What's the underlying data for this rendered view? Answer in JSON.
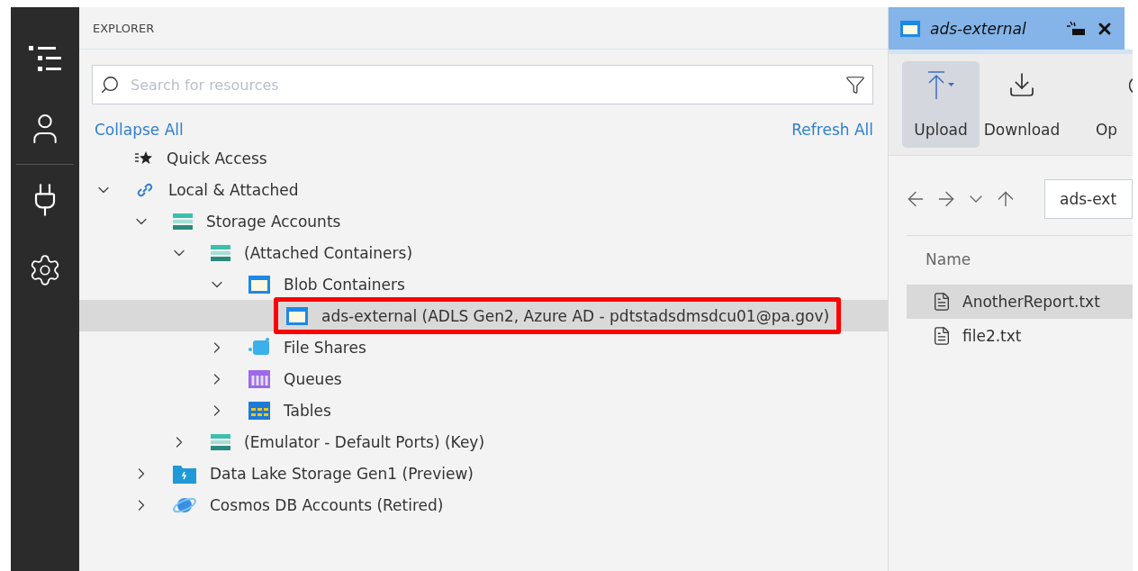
{
  "explorer": {
    "title": "EXPLORER",
    "search": {
      "placeholder": "Search for resources"
    },
    "actions": {
      "collapse": "Collapse All",
      "refresh": "Refresh All"
    },
    "tree": [
      {
        "label": "Quick Access",
        "kind": "quick",
        "selected": false
      },
      {
        "label": "Local & Attached",
        "kind": "link",
        "expanded": true,
        "selected": false,
        "children": [
          {
            "label": "Storage Accounts",
            "kind": "storage",
            "expanded": true,
            "selected": false,
            "children": [
              {
                "label": "(Attached Containers)",
                "kind": "storage",
                "expanded": true,
                "selected": false,
                "children": [
                  {
                    "label": "Blob Containers",
                    "kind": "blob",
                    "expanded": true,
                    "selected": false,
                    "children": [
                      {
                        "label": "ads-external (ADLS Gen2, Azure AD - pdtstadsdmsdcu01@pa.gov)",
                        "kind": "blob",
                        "selected": true,
                        "highlighted": true
                      }
                    ]
                  },
                  {
                    "label": "File Shares",
                    "kind": "share",
                    "expanded": false,
                    "selected": false
                  },
                  {
                    "label": "Queues",
                    "kind": "queue",
                    "expanded": false,
                    "selected": false
                  },
                  {
                    "label": "Tables",
                    "kind": "table",
                    "expanded": false,
                    "selected": false
                  }
                ]
              },
              {
                "label": "(Emulator - Default Ports) (Key)",
                "kind": "storage",
                "expanded": false,
                "selected": false
              }
            ]
          },
          {
            "label": "Data Lake Storage Gen1 (Preview)",
            "kind": "lake",
            "expanded": false,
            "selected": false
          },
          {
            "label": "Cosmos DB Accounts (Retired)",
            "kind": "cosmos",
            "expanded": false,
            "selected": false
          }
        ]
      }
    ]
  },
  "editor": {
    "tab": {
      "title": "ads-external"
    },
    "toolbar": [
      {
        "label": "Upload",
        "kind": "upload",
        "selected": true
      },
      {
        "label": "Download",
        "kind": "download",
        "selected": false
      },
      {
        "label": "Op",
        "kind": "open",
        "selected": false
      }
    ],
    "address": "ads-ext",
    "columns": [
      "Name"
    ],
    "files": [
      {
        "name": "AnotherReport.txt",
        "selected": true
      },
      {
        "name": "file2.txt",
        "selected": false
      }
    ]
  }
}
